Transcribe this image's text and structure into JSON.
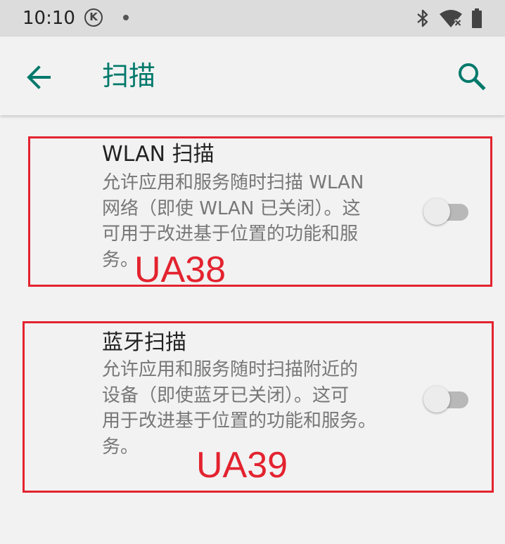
{
  "status_bar": {
    "time": "10:10",
    "k_badge": "K",
    "icons": [
      "bluetooth-icon",
      "wifi-no-internet-icon",
      "battery-icon"
    ]
  },
  "app_bar": {
    "title": "扫描",
    "back_icon": "arrow-back-icon",
    "search_icon": "search-icon",
    "accent_color": "#00796b"
  },
  "settings": [
    {
      "title": "WLAN 扫描",
      "summary_lines": [
        "允许应用和服务随时扫描 WLAN",
        "网络（即使 WLAN 已关闭）。这",
        "可用于改进基于位置的功能和服",
        "务。"
      ],
      "enabled": false,
      "annotation": "UA38"
    },
    {
      "title": "蓝牙扫描",
      "summary_lines": [
        "允许应用和服务随时扫描附近的",
        "设备（即使蓝牙已关闭）。这可",
        "用于改进基于位置的功能和服务。",
        "务。"
      ],
      "enabled": false,
      "annotation": "UA39"
    }
  ],
  "annotation_color": "#e3232f"
}
